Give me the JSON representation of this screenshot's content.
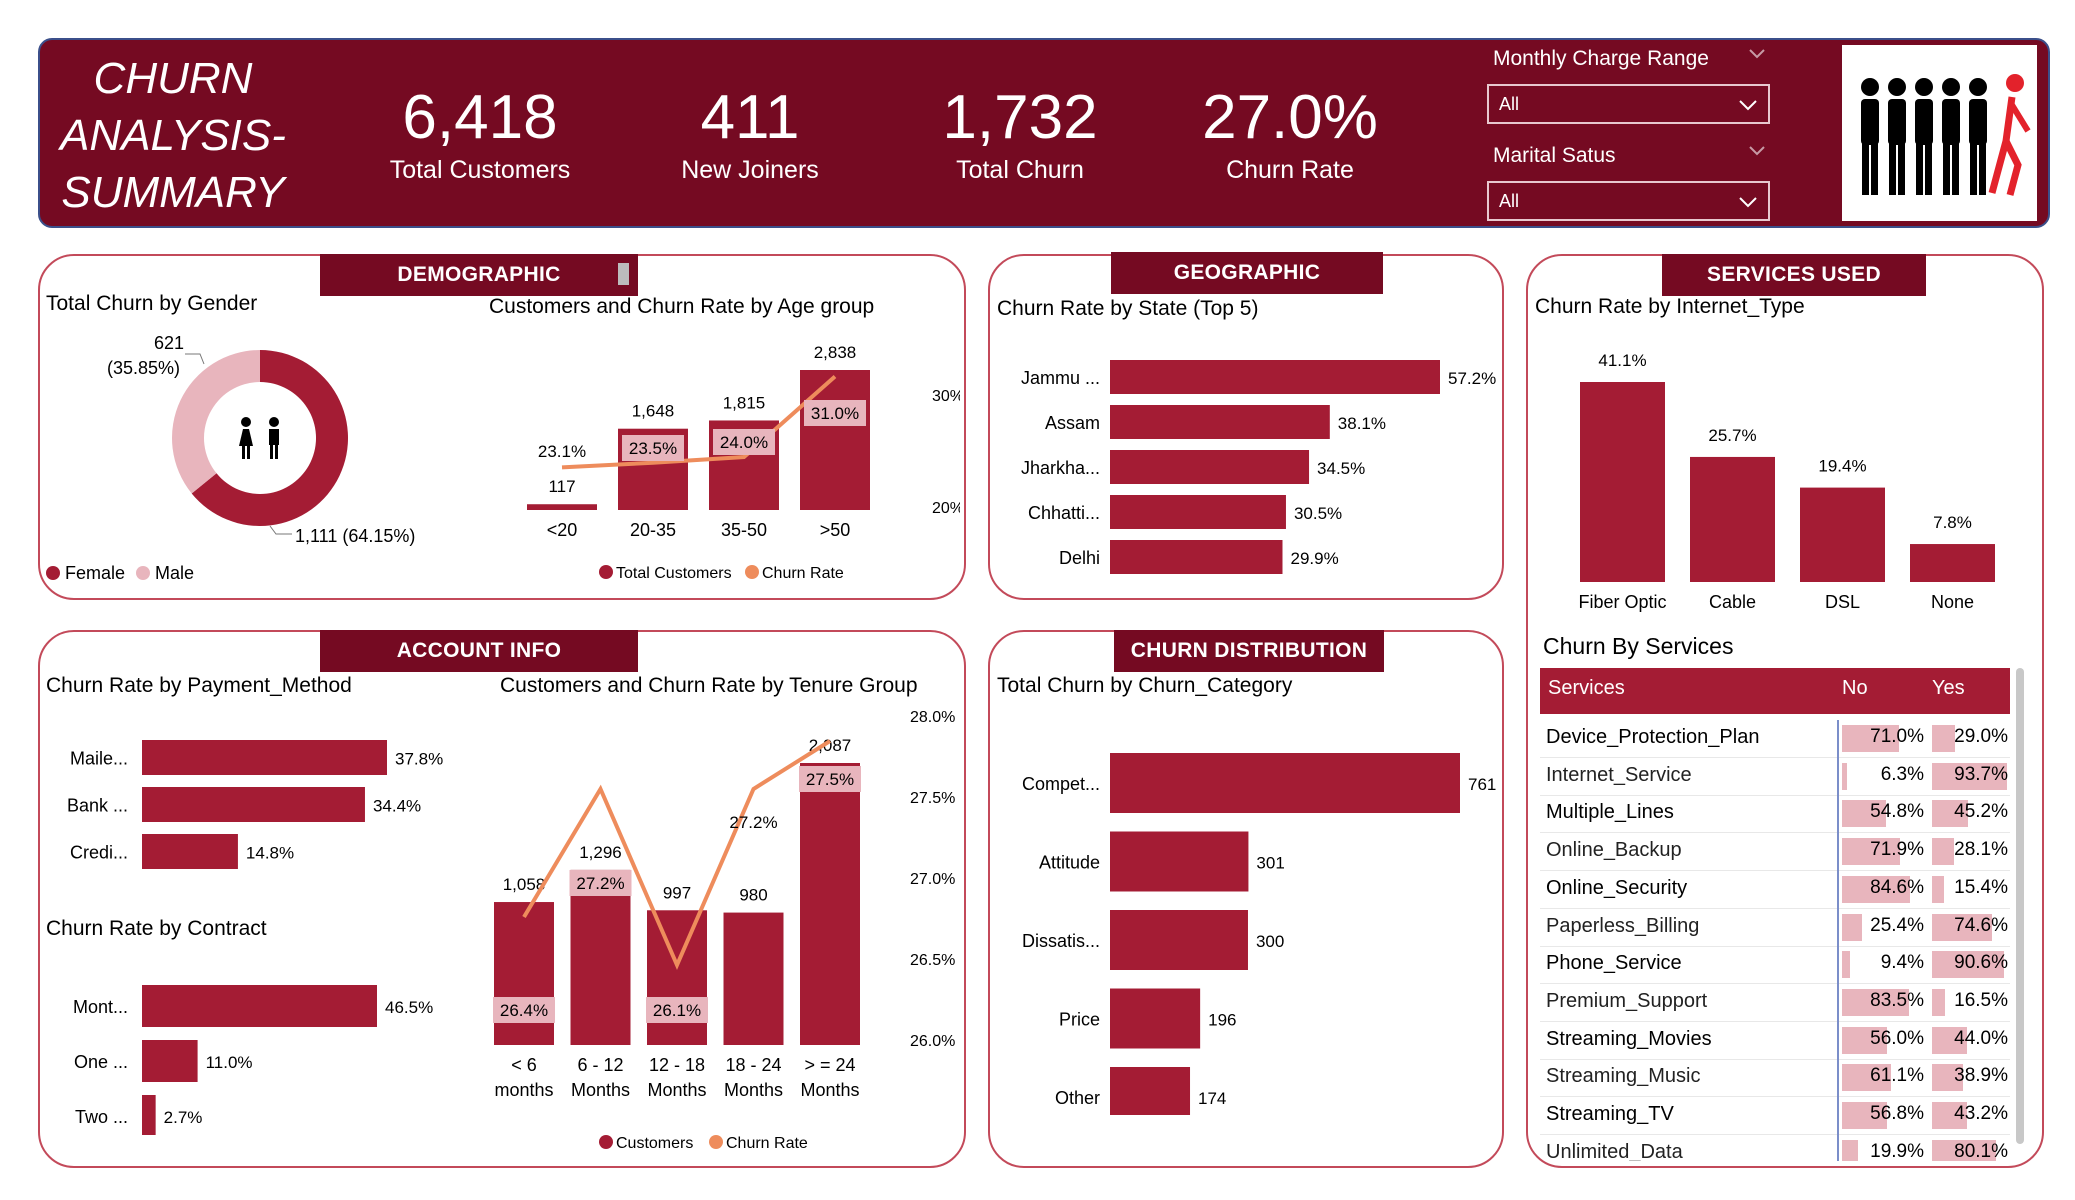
{
  "header": {
    "title": [
      "CHURN",
      "ANALYSIS-",
      "SUMMARY"
    ],
    "kpis": [
      {
        "value": "6,418",
        "label": "Total Customers"
      },
      {
        "value": "411",
        "label": "New Joiners"
      },
      {
        "value": "1,732",
        "label": "Total Churn"
      },
      {
        "value": "27.0%",
        "label": "Churn Rate"
      }
    ],
    "filters": [
      {
        "title": "Monthly Charge Range",
        "selected": "All"
      },
      {
        "title": "Marital Satus",
        "selected": "All"
      }
    ]
  },
  "colors": {
    "primary": "#750a22",
    "bar": "#a41c34",
    "light": "#e8b5bd",
    "line": "#ee8c5c",
    "border": "#c34a5a"
  },
  "panels": {
    "demographic": "DEMOGRAPHIC",
    "geographic": "GEOGRAPHIC",
    "services": "SERVICES USED",
    "account": "ACCOUNT INFO",
    "distribution": "CHURN DISTRIBUTION"
  },
  "charts": {
    "gender": {
      "title": "Total Churn by Gender",
      "female_label": "1,111 (64.15%)",
      "male_label_value": "621",
      "male_label_pct": "(35.85%)",
      "legend": [
        "Female",
        "Male"
      ]
    },
    "age": {
      "title": "Customers and Churn Rate by Age group",
      "legend": [
        "Total Customers",
        "Churn Rate"
      ],
      "right_ticks": [
        "30%",
        "20%"
      ]
    },
    "state": {
      "title": "Churn Rate by State (Top 5)"
    },
    "internet": {
      "title": "Churn Rate by Internet_Type"
    },
    "payment": {
      "title": "Churn Rate by Payment_Method"
    },
    "contract": {
      "title": "Churn Rate by Contract"
    },
    "tenure": {
      "title": "Customers and Churn Rate by Tenure Group",
      "legend": [
        "Customers",
        "Churn Rate"
      ],
      "right_ticks": [
        "28.0%",
        "27.5%",
        "27.0%",
        "26.5%",
        "26.0%"
      ]
    },
    "category": {
      "title": "Total Churn by Churn_Category"
    },
    "services": {
      "title": "Churn By Services",
      "headers": [
        "Services",
        "No",
        "Yes"
      ],
      "rows": [
        {
          "name": "Device_Protection_Plan",
          "no": "71.0%",
          "yes": "29.0%"
        },
        {
          "name": "Internet_Service",
          "no": "6.3%",
          "yes": "93.7%"
        },
        {
          "name": "Multiple_Lines",
          "no": "54.8%",
          "yes": "45.2%"
        },
        {
          "name": "Online_Backup",
          "no": "71.9%",
          "yes": "28.1%"
        },
        {
          "name": "Online_Security",
          "no": "84.6%",
          "yes": "15.4%"
        },
        {
          "name": "Paperless_Billing",
          "no": "25.4%",
          "yes": "74.6%"
        },
        {
          "name": "Phone_Service",
          "no": "9.4%",
          "yes": "90.6%"
        },
        {
          "name": "Premium_Support",
          "no": "83.5%",
          "yes": "16.5%"
        },
        {
          "name": "Streaming_Movies",
          "no": "56.0%",
          "yes": "44.0%"
        },
        {
          "name": "Streaming_Music",
          "no": "61.1%",
          "yes": "38.9%"
        },
        {
          "name": "Streaming_TV",
          "no": "56.8%",
          "yes": "43.2%"
        },
        {
          "name": "Unlimited_Data",
          "no": "19.9%",
          "yes": "80.1%"
        }
      ]
    }
  },
  "chart_data": [
    {
      "type": "pie",
      "title": "Total Churn by Gender",
      "categories": [
        "Female",
        "Male"
      ],
      "values": [
        1111,
        621
      ],
      "percent": [
        64.15,
        35.85
      ]
    },
    {
      "type": "bar",
      "title": "Customers and Churn Rate by Age group",
      "categories": [
        "<20",
        "20-35",
        "35-50",
        ">50"
      ],
      "series": [
        {
          "name": "Total Customers",
          "values": [
            117,
            1648,
            1815,
            2838
          ]
        },
        {
          "name": "Churn Rate",
          "values": [
            23.1,
            23.5,
            24.0,
            31.0
          ],
          "labels": [
            "23.1%",
            "23.5%",
            "24.0%",
            "31.0%"
          ]
        }
      ]
    },
    {
      "type": "bar",
      "title": "Churn Rate by State (Top 5)",
      "categories": [
        "Jammu ...",
        "Assam",
        "Jharkha...",
        "Chhatti...",
        "Delhi"
      ],
      "values": [
        57.2,
        38.1,
        34.5,
        30.5,
        29.9
      ],
      "labels": [
        "57.2%",
        "38.1%",
        "34.5%",
        "30.5%",
        "29.9%"
      ]
    },
    {
      "type": "bar",
      "title": "Churn Rate by Internet_Type",
      "categories": [
        "Fiber Optic",
        "Cable",
        "DSL",
        "None"
      ],
      "values": [
        41.1,
        25.7,
        19.4,
        7.8
      ],
      "labels": [
        "41.1%",
        "25.7%",
        "19.4%",
        "7.8%"
      ]
    },
    {
      "type": "bar",
      "title": "Churn Rate by Payment_Method",
      "categories": [
        "Maile...",
        "Bank ...",
        "Credi..."
      ],
      "values": [
        37.8,
        34.4,
        14.8
      ],
      "labels": [
        "37.8%",
        "34.4%",
        "14.8%"
      ]
    },
    {
      "type": "bar",
      "title": "Churn Rate by Contract",
      "categories": [
        "Mont...",
        "One ...",
        "Two ..."
      ],
      "values": [
        46.5,
        11.0,
        2.7
      ],
      "labels": [
        "46.5%",
        "11.0%",
        "2.7%"
      ]
    },
    {
      "type": "bar",
      "title": "Customers and Churn Rate by Tenure Group",
      "categories": [
        "< 6 months",
        "6 - 12 Months",
        "12 - 18 Months",
        "18 - 24 Months",
        "> = 24 Months"
      ],
      "series": [
        {
          "name": "Customers",
          "values": [
            1058,
            1296,
            997,
            980,
            2087
          ]
        },
        {
          "name": "Churn Rate",
          "values": [
            26.4,
            27.2,
            26.1,
            27.2,
            27.5
          ],
          "labels": [
            "26.4%",
            "27.2%",
            "26.1%",
            "27.2%",
            "27.5%"
          ]
        }
      ],
      "y2lim": [
        26.0,
        28.0
      ]
    },
    {
      "type": "bar",
      "title": "Total Churn by Churn_Category",
      "categories": [
        "Compet...",
        "Attitude",
        "Dissatis...",
        "Price",
        "Other"
      ],
      "values": [
        761,
        301,
        300,
        196,
        174
      ]
    }
  ]
}
